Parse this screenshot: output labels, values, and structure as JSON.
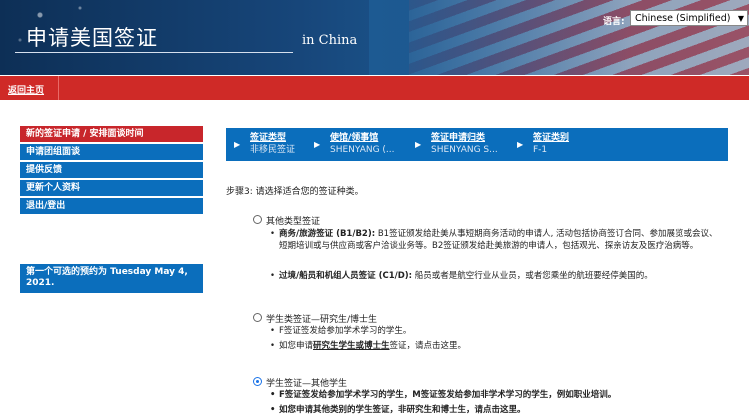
{
  "header": {
    "title": "申请美国签证",
    "subtitle": "in China",
    "language_label": "语言:",
    "language_value": "Chinese (Simplified)"
  },
  "topbar": {
    "home_link": "返回主页"
  },
  "sidebar": {
    "items": [
      {
        "label": "新的签证申请 / 安排面谈时间"
      },
      {
        "label": "申请团组面谈"
      },
      {
        "label": "提供反馈"
      },
      {
        "label": "更新个人资料"
      },
      {
        "label": "退出/登出"
      }
    ],
    "appointment_notice": "第一个可选的预约为 Tuesday May 4, 2021."
  },
  "breadcrumbs": [
    {
      "label": "签证类型",
      "value": "非移民签证"
    },
    {
      "label": "使馆/领事馆",
      "value": "SHENYANG (..."
    },
    {
      "label": "签证申请归类",
      "value": "SHENYANG S..."
    },
    {
      "label": "签证类别",
      "value": "F-1"
    }
  ],
  "step_text": "步骤3: 请选择适合您的签证种类。",
  "options": [
    {
      "title": "其他类型签证",
      "selected": false,
      "bullets": [
        {
          "bold": "商务/旅游签证 (B1/B2):",
          "text": " B1签证颁发给赴美从事短期商务活动的申请人, 活动包括协商签订合同、参加展览或会议、短期培训或与供应商或客户洽谈业务等。B2签证颁发给赴美旅游的申请人，包括观光、探亲访友及医疗治病等。"
        },
        {
          "bold": "过境/船员和机组人员签证 (C1/D):",
          "text": " 船员或者是航空行业从业员，或者您乘坐的航班要经停美国的。"
        }
      ]
    },
    {
      "title": "学生类签证—研究生/博士生",
      "selected": false,
      "bullets": [
        {
          "text": "F签证签发给参加学术学习的学生。"
        },
        {
          "pre": "如您申请",
          "link": "研究生学生或博士生",
          "post": "签证，请点击这里。"
        }
      ]
    },
    {
      "title": "学生签证—其他学生",
      "selected": true,
      "bullets": [
        {
          "text": "F签证签发给参加学术学习的学生，M签证签发给参加非学术学习的学生，例如职业培训。"
        },
        {
          "text": "如您申请其他类别的学生签证，非研究生和博士生，请点击这里。"
        }
      ]
    }
  ]
}
